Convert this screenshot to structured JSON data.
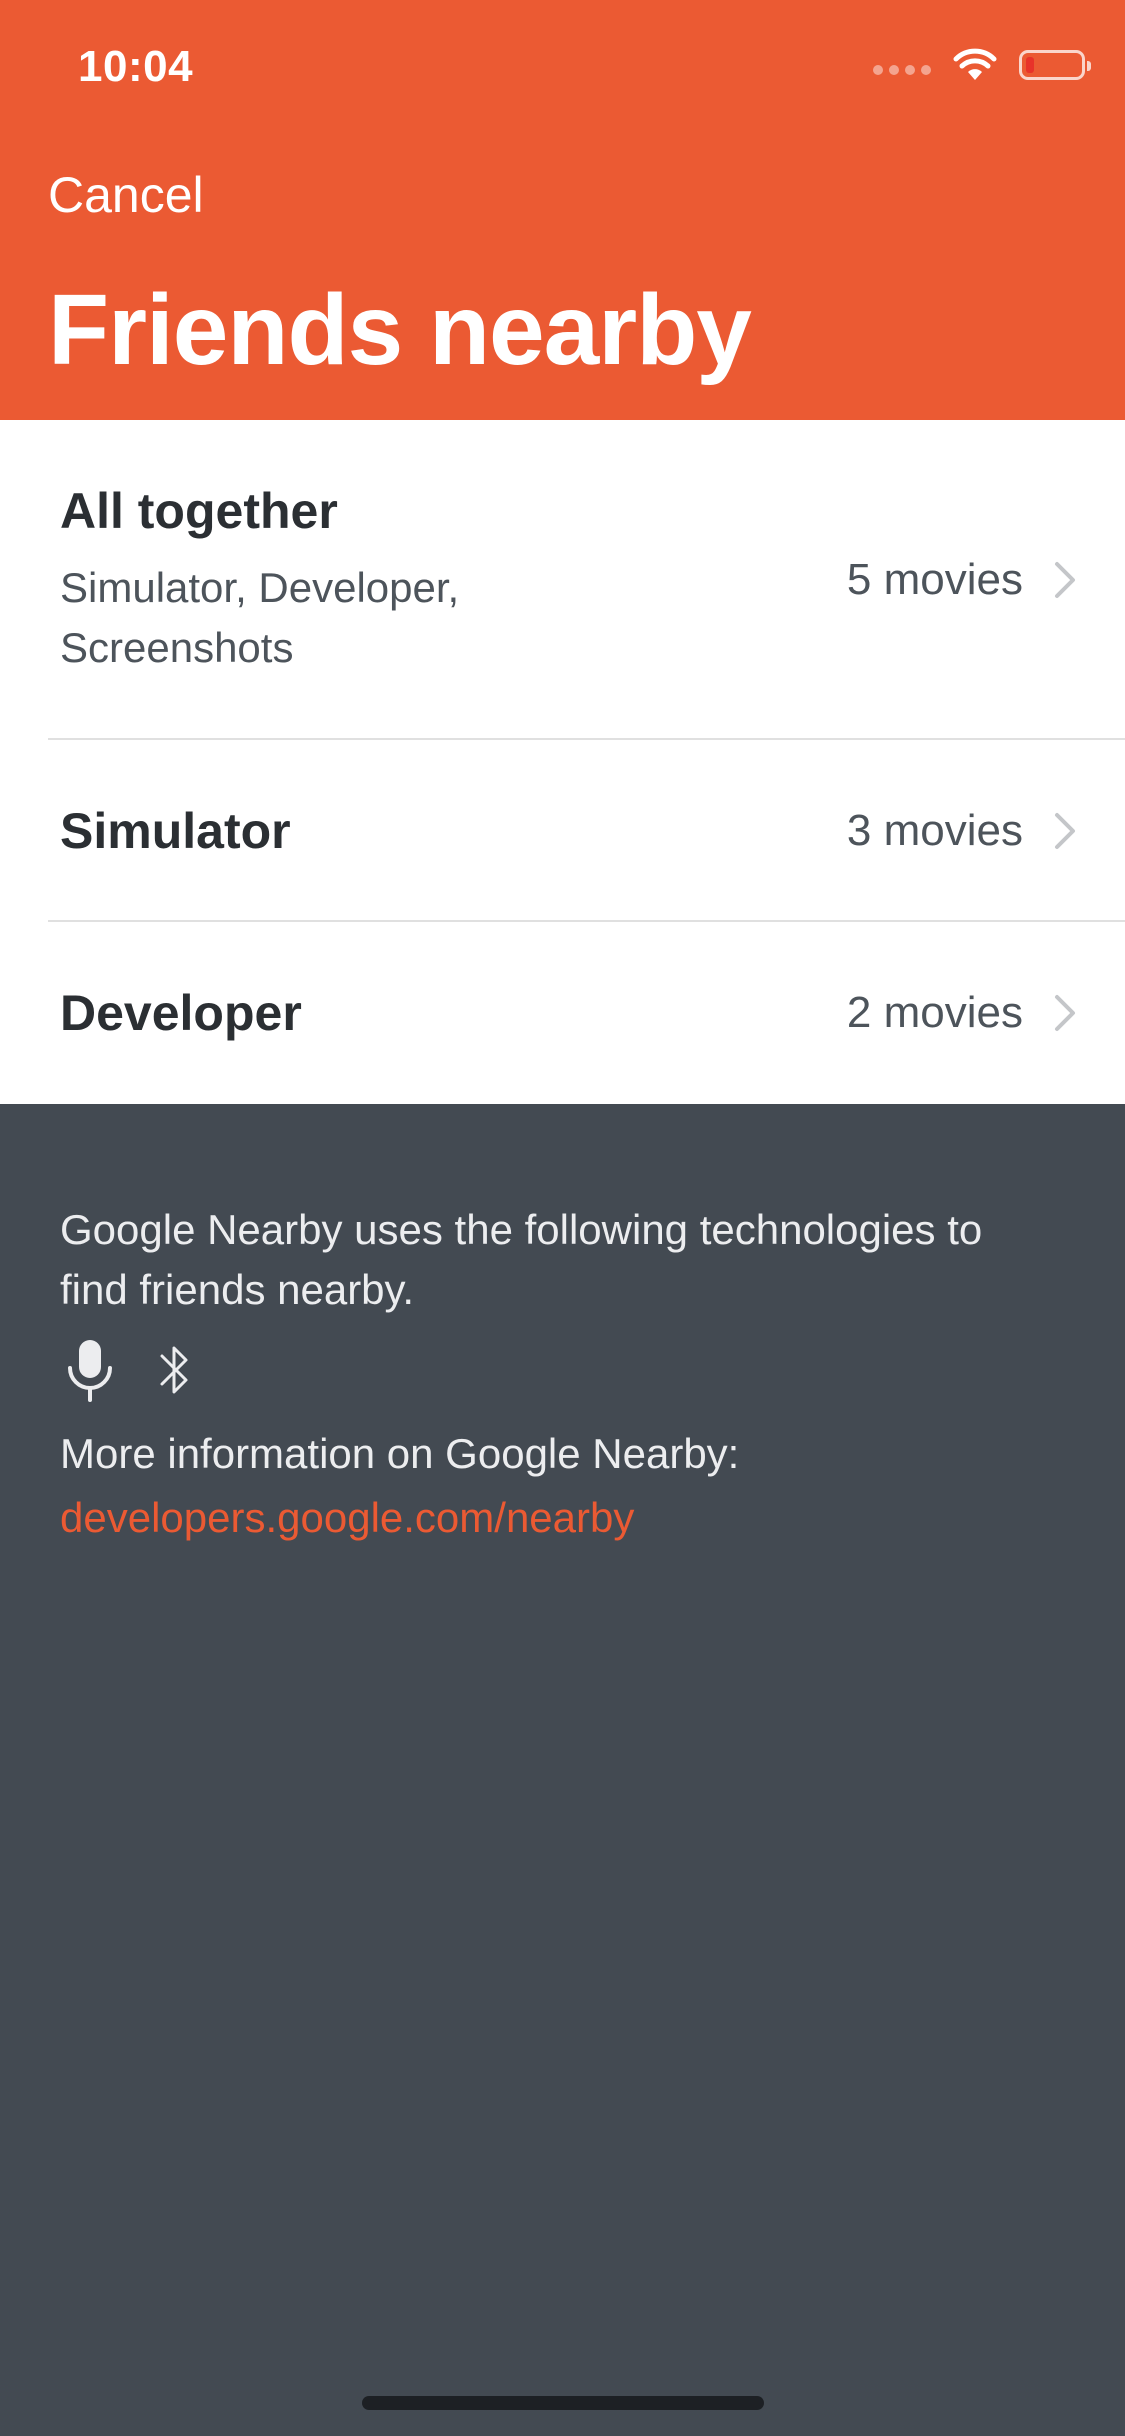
{
  "status_bar": {
    "time": "10:04"
  },
  "header": {
    "cancel_label": "Cancel",
    "title": "Friends nearby"
  },
  "groups": [
    {
      "name": "All together",
      "subtitle": "Simulator, Developer, Screenshots",
      "count": "5 movies"
    },
    {
      "name": "Simulator",
      "count": "3 movies"
    },
    {
      "name": "Developer",
      "count": "2 movies"
    }
  ],
  "footer": {
    "description": "Google Nearby uses the following technologies to find friends nearby.",
    "tech_icons": [
      "microphone-icon",
      "bluetooth-icon"
    ],
    "more_info": "More information on Google Nearby:",
    "link": "developers.google.com/nearby"
  },
  "colors": {
    "accent": "#eb5a33",
    "background_dark": "#434a52",
    "list_background": "#ffffff"
  }
}
